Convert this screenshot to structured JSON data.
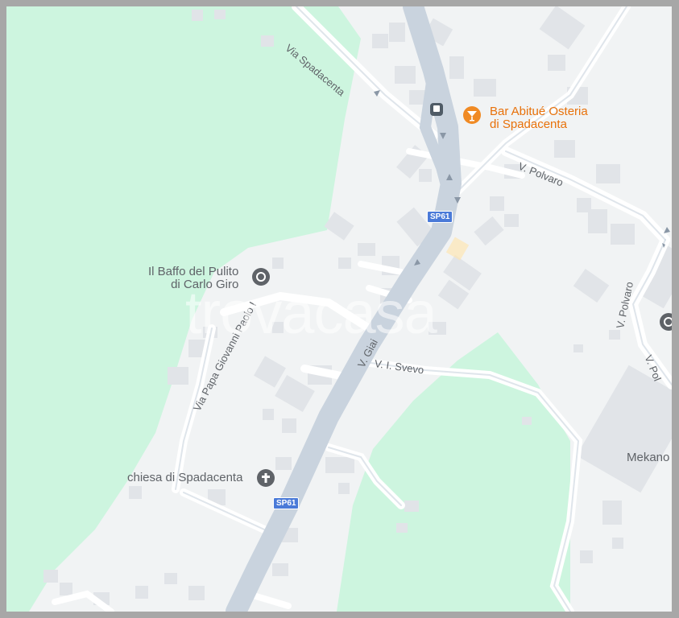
{
  "map": {
    "watermark": "trovacasa",
    "pois": [
      {
        "name": "bar",
        "line1": "Bar Abitué Osteria",
        "line2": "di Spadacenta",
        "icon": "cocktail-icon",
        "color": "#e8710a"
      },
      {
        "name": "baffo",
        "line1": "Il Baffo del Pulito",
        "line2": "di Carlo Giro",
        "icon": "place-pin-icon",
        "color": "#5f6368"
      },
      {
        "name": "chiesa",
        "line1": "chiesa di Spadacenta",
        "icon": "church-cross-icon",
        "color": "#5f6368"
      },
      {
        "name": "mekano",
        "line1": "Mekano",
        "icon": "place-pin-icon",
        "color": "#5f6368"
      }
    ],
    "streets": {
      "via_spadacenta": "Via Spadacenta",
      "v_polvaro_top": "V. Polvaro",
      "v_polvaro_side": "V. Polvaro",
      "v_polvaro_right": "V. Pol",
      "v_giai": "V. Giai",
      "via_papa": "Via Papa Giovanni Paolo I",
      "v_svevo": "V. I. Svevo"
    },
    "shields": {
      "sp61_top": "SP61",
      "sp61_bottom": "SP61"
    },
    "colors": {
      "park": "#cdf5df",
      "land": "#f1f3f4",
      "road": "#ffffff",
      "major_road": "#c9d3de",
      "building": "#e3e6ea"
    }
  }
}
